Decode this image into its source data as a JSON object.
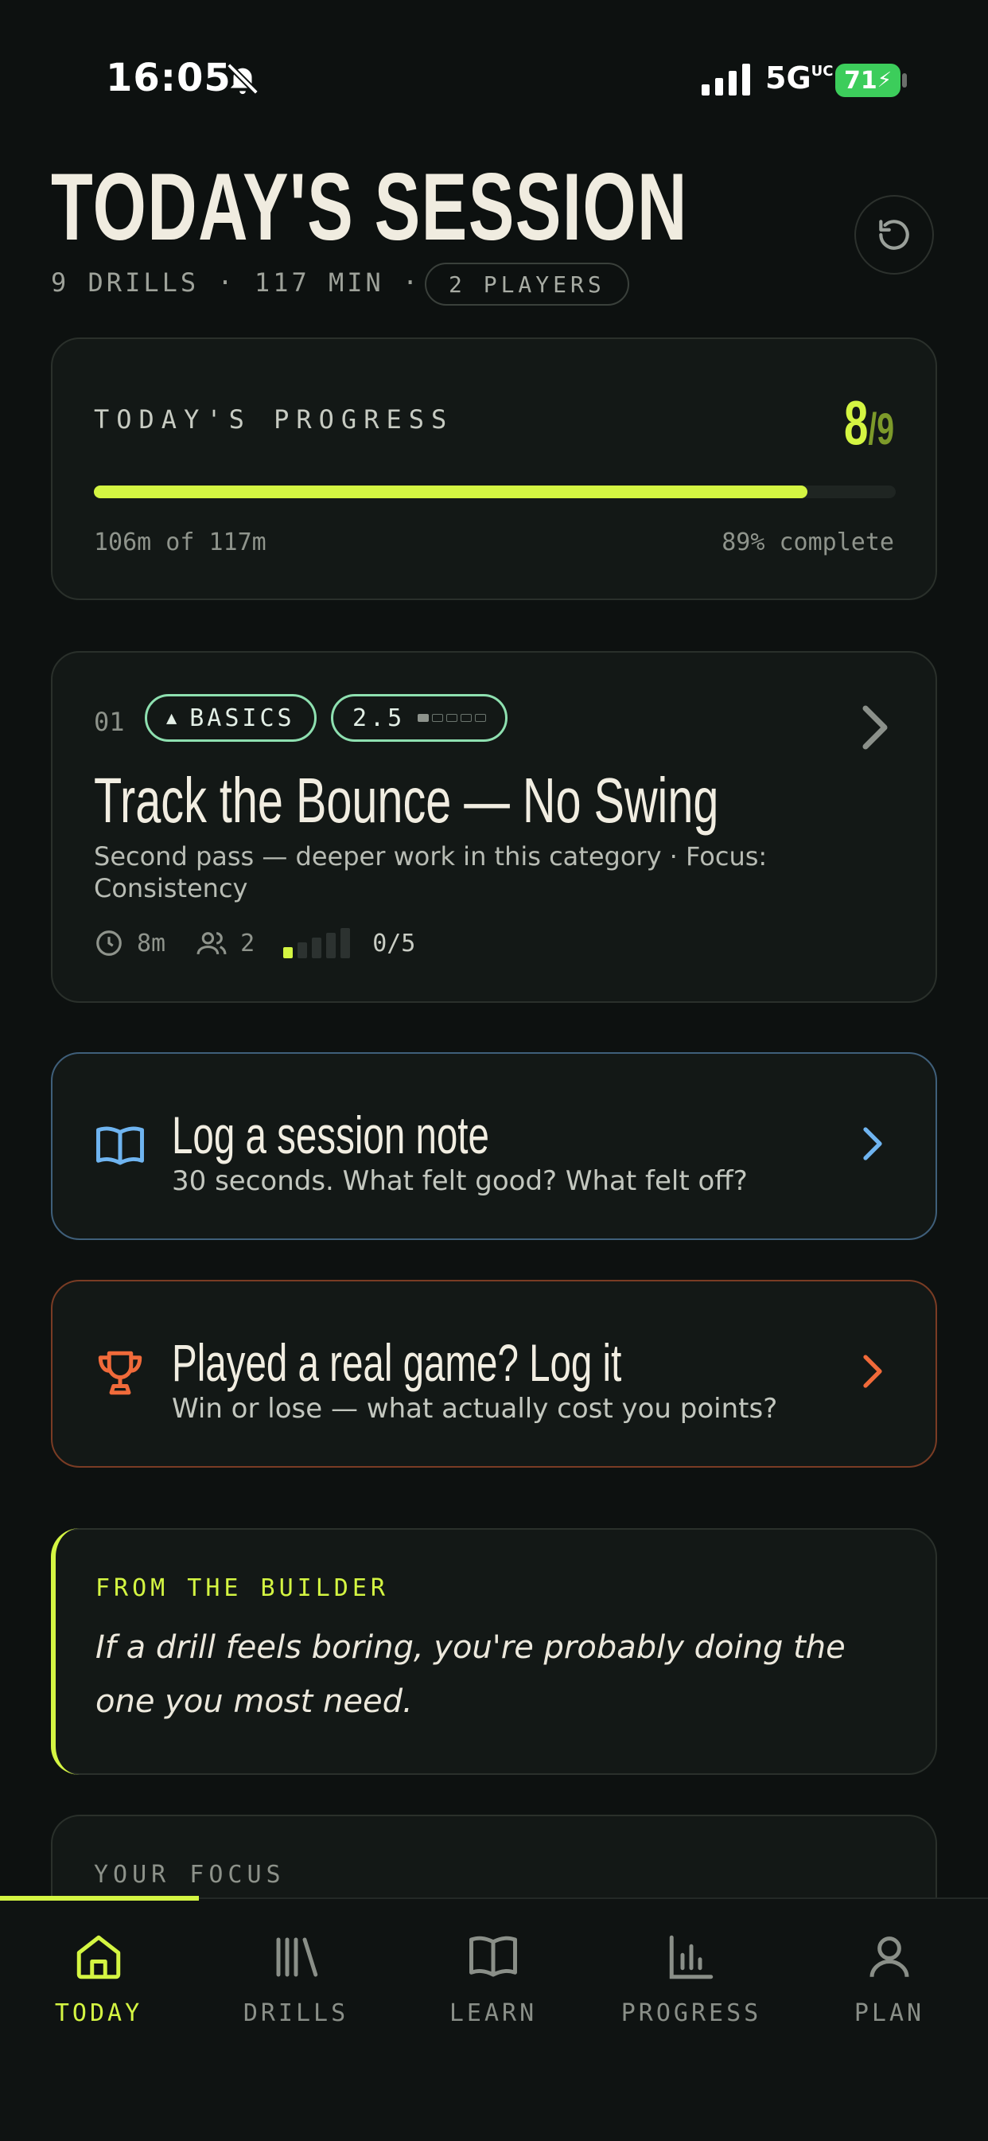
{
  "status_bar": {
    "time": "16:05",
    "network": "5G",
    "network_suffix": "UC",
    "battery": "71"
  },
  "header": {
    "title": "TODAY'S SESSION",
    "meta": "9 DRILLS · 117 MIN ·",
    "players": "2 PLAYERS"
  },
  "progress": {
    "label": "TODAY'S PROGRESS",
    "done": "8",
    "total": "/9",
    "fraction": 0.89,
    "minutes": "106m of 117m",
    "percent": "89% complete"
  },
  "drill": {
    "number": "01",
    "category": "BASICS",
    "level": "2.5",
    "level_dots_filled": 1,
    "level_dots_total": 5,
    "title": "Track the Bounce — No Swing",
    "description": "Second pass — deeper work in this category · Focus: Consistency",
    "duration": "8m",
    "players": "2",
    "reps": "0/5",
    "reps_done": 0,
    "reps_total": 5
  },
  "note_card": {
    "title": "Log a session note",
    "subtitle": "30 seconds. What felt good? What felt off?",
    "color": "#6fb4f0"
  },
  "game_card": {
    "title": "Played a real game? Log it",
    "subtitle": "Win or lose — what actually cost you points?",
    "color": "#f06a3a"
  },
  "builder": {
    "label": "FROM THE BUILDER",
    "quote": "If a drill feels boring, you're probably doing the one you most need."
  },
  "focus": {
    "label": "YOUR FOCUS"
  },
  "tabs": [
    {
      "label": "TODAY",
      "icon": "home-icon",
      "active": true
    },
    {
      "label": "DRILLS",
      "icon": "library-icon",
      "active": false
    },
    {
      "label": "LEARN",
      "icon": "book-icon",
      "active": false
    },
    {
      "label": "PROGRESS",
      "icon": "bar-chart-icon",
      "active": false
    },
    {
      "label": "PLAN",
      "icon": "user-icon",
      "active": false
    }
  ],
  "colors": {
    "accent": "#d4f542",
    "background": "#0d1110",
    "card": "#131816"
  }
}
